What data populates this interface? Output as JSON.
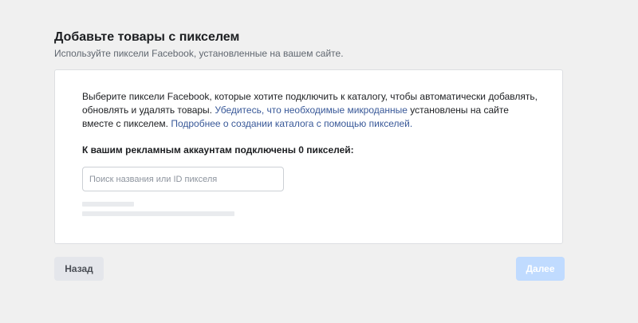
{
  "header": {
    "title": "Добавьте товары с пикселем",
    "subtitle": "Используйте пиксели Facebook, установленные на вашем сайте."
  },
  "card": {
    "description_part1": "Выберите пиксели Facebook, которые хотите подключить к каталогу, чтобы автоматически добавлять, обновлять и удалять товары. ",
    "description_link1": "Убедитесь, что необходимые микроданные",
    "description_part2": " установлены на сайте вместе с пикселем. ",
    "description_link2": "Подробнее о создании каталога с помощью пикселей.",
    "count_label": "К вашим рекламным аккаунтам подключены 0 пикселей:",
    "search": {
      "placeholder": "Поиск названия или ID пикселя",
      "value": ""
    }
  },
  "footer": {
    "back_label": "Назад",
    "next_label": "Далее"
  },
  "colors": {
    "link": "#385898",
    "next_button_disabled": "#c0dbff",
    "back_button": "#e4e6eb"
  }
}
